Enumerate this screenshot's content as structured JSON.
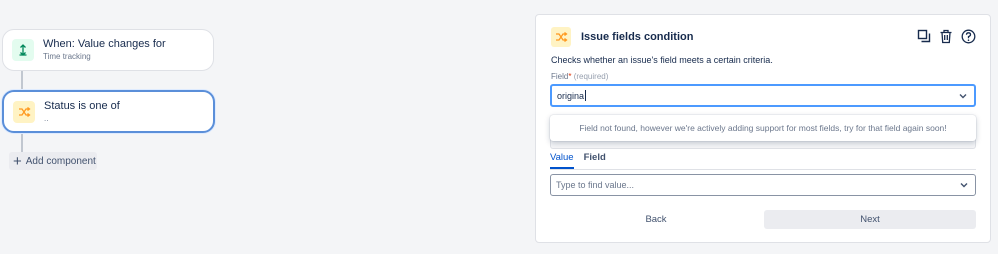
{
  "flow": {
    "trigger": {
      "title": "When: Value changes for",
      "subtitle": "Time tracking",
      "icon": "arrow-updown-icon"
    },
    "condition": {
      "title": "Status is one of",
      "subtitle": "..",
      "icon": "shuffle-icon"
    },
    "add_component_label": "Add component"
  },
  "panel": {
    "title": "Issue fields condition",
    "icon": "shuffle-icon",
    "description": "Checks whether an issue's field meets a certain criteria.",
    "field_label": "Field",
    "required_marker": "*",
    "required_text": "(required)",
    "field_value": "origina",
    "not_found_message": "Field not found, however we're actively adding support for most fields, try for that field again soon!",
    "tabs": [
      {
        "label": "Value",
        "active": true
      },
      {
        "label": "Field",
        "active": false
      }
    ],
    "value_placeholder": "Type to find value...",
    "back_label": "Back",
    "next_label": "Next"
  },
  "colors": {
    "accent": "#0052cc",
    "focus_border": "#4c9aff",
    "trigger_icon_bg": "#e3fcef",
    "condition_icon_bg": "#fff3c4",
    "condition_icon": "#ff991f"
  }
}
